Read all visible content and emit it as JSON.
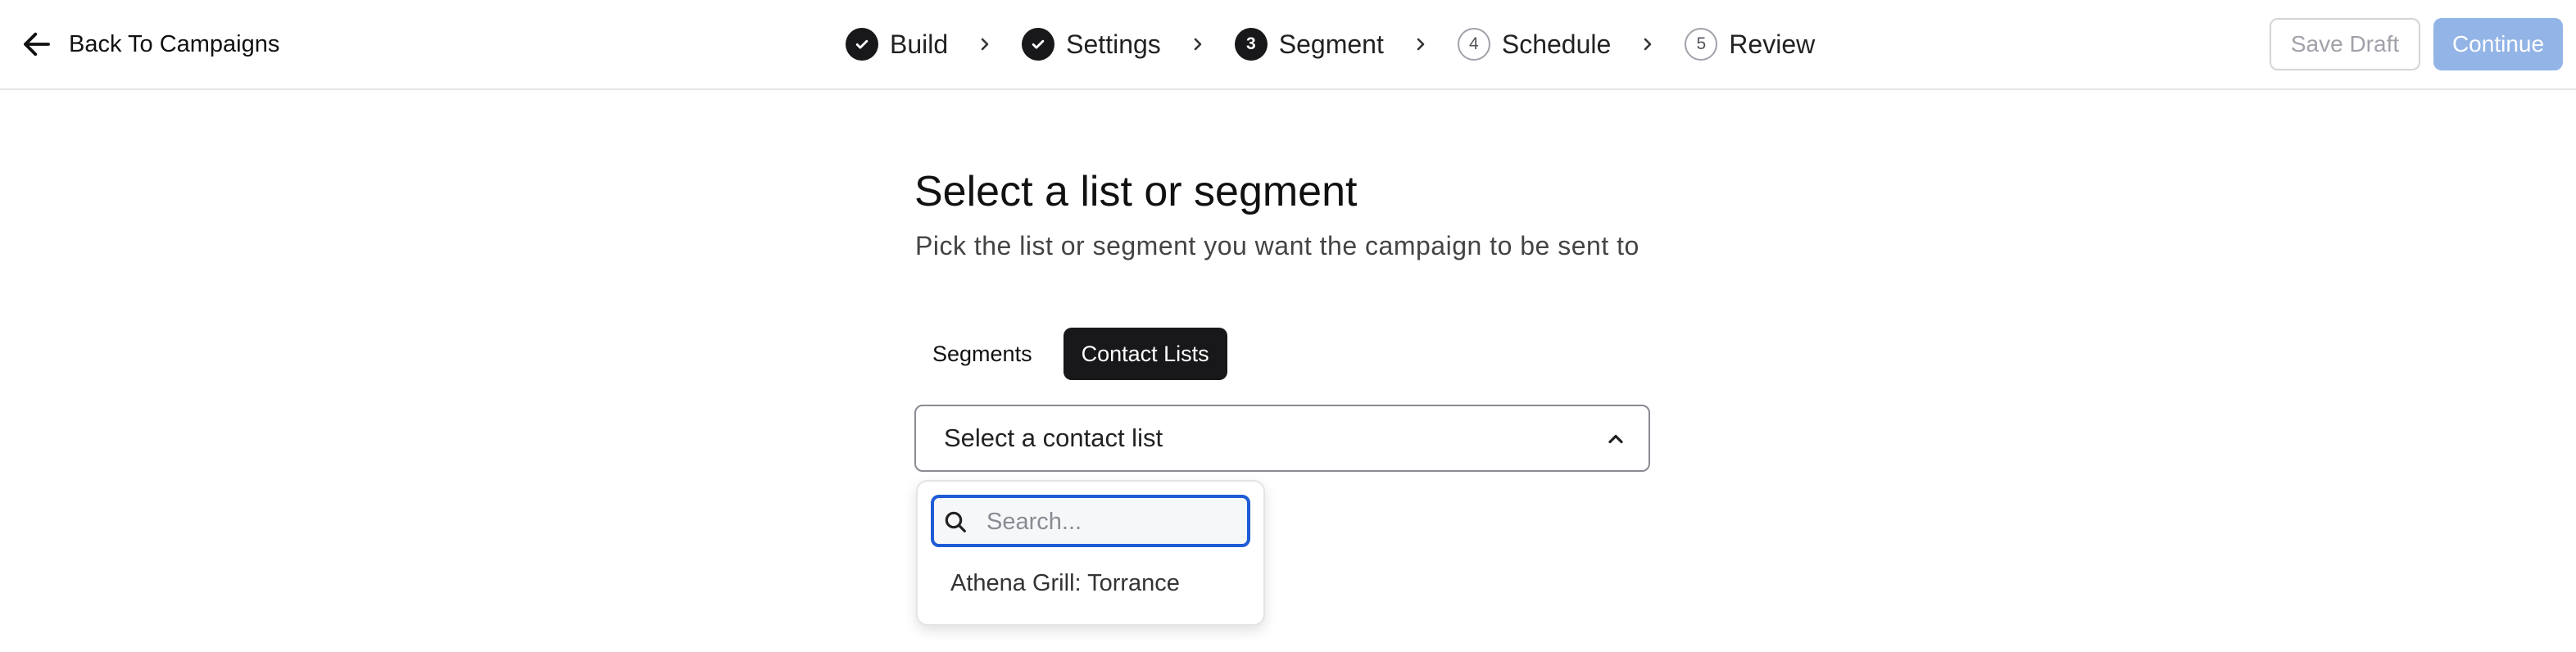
{
  "header": {
    "back_label": "Back To Campaigns",
    "steps": [
      {
        "number": "1",
        "label": "Build",
        "status": "done"
      },
      {
        "number": "2",
        "label": "Settings",
        "status": "done"
      },
      {
        "number": "3",
        "label": "Segment",
        "status": "current"
      },
      {
        "number": "4",
        "label": "Schedule",
        "status": "future"
      },
      {
        "number": "5",
        "label": "Review",
        "status": "future"
      }
    ],
    "save_draft_label": "Save Draft",
    "continue_label": "Continue"
  },
  "main": {
    "title": "Select a list or segment",
    "subtitle": "Pick the list or segment you want the campaign to be sent to",
    "tabs": [
      {
        "label": "Segments",
        "active": false
      },
      {
        "label": "Contact Lists",
        "active": true
      }
    ],
    "select": {
      "value": "Select a contact list",
      "search_placeholder": "Search...",
      "options": [
        "Athena Grill: Torrance"
      ]
    }
  },
  "colors": {
    "accent_dark": "#18181b",
    "continue_disabled": "#93b4e6",
    "focus_ring": "#1e5bd6"
  },
  "icons": {
    "back": "arrow-left-icon",
    "done_step": "check-icon",
    "separator": "chevron-right-icon",
    "select_caret": "chevron-up-icon",
    "search": "search-icon"
  }
}
